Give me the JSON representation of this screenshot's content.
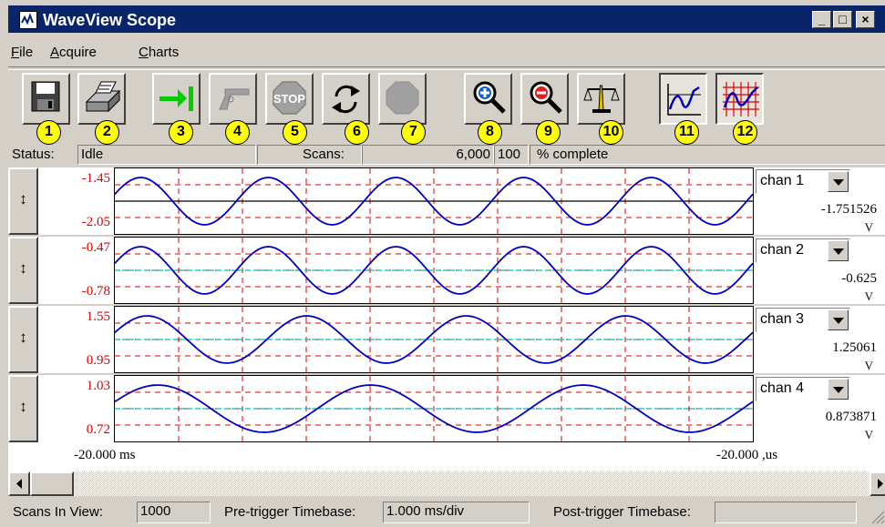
{
  "window": {
    "title": "WaveView Scope",
    "controls": [
      "_",
      "□",
      "×"
    ]
  },
  "menu": [
    {
      "label": "File",
      "accel": "F",
      "rest": "ile"
    },
    {
      "label": "Acquire",
      "accel": "A",
      "rest": "cquire"
    },
    {
      "label": "Charts",
      "accel": "C",
      "rest": "harts"
    }
  ],
  "toolbar": {
    "buttons": [
      {
        "icon": "save-disk-icon",
        "badge": "1"
      },
      {
        "icon": "printer-icon",
        "badge": "2"
      },
      {
        "icon": "arm-trigger-arrow-icon",
        "badge": "3"
      },
      {
        "icon": "trigger-gun-icon",
        "badge": "4"
      },
      {
        "icon": "stop-sign-icon",
        "badge": "5"
      },
      {
        "icon": "cycle-arrows-icon",
        "badge": "6"
      },
      {
        "icon": "octagon-icon",
        "badge": "7"
      },
      {
        "icon": "zoom-in-icon",
        "badge": "8"
      },
      {
        "icon": "zoom-out-icon",
        "badge": "9"
      },
      {
        "icon": "scale-balance-icon",
        "badge": "10"
      },
      {
        "icon": "single-chart-icon",
        "badge": "11"
      },
      {
        "icon": "multi-chart-grid-icon",
        "badge": "12"
      }
    ]
  },
  "status": {
    "status_label": "Status:",
    "status_value": "Idle",
    "scans_label": "Scans:",
    "scans_value": "6,000",
    "percent_value": "100",
    "percent_label": "% complete"
  },
  "channels": [
    {
      "ymax": "-1.45",
      "ymin": "-2.05",
      "name": "chan 1",
      "value": "-1.751526",
      "unit": "V",
      "cycles": 5.0,
      "phase": 0.0,
      "mid_line": true,
      "mid_color": "#000000"
    },
    {
      "ymax": "-0.47",
      "ymin": "-0.78",
      "name": "chan 2",
      "value": "-0.625",
      "unit": "V",
      "cycles": 5.0,
      "phase": 0.0,
      "mid_line": true,
      "mid_color": "#00c0c0"
    },
    {
      "ymax": "1.55",
      "ymin": "0.95",
      "name": "chan 3",
      "value": "1.25061",
      "unit": "V",
      "cycles": 4.0,
      "phase": 0.0,
      "mid_line": true,
      "mid_color": "#00c0c0"
    },
    {
      "ymax": "1.03",
      "ymin": "0.72",
      "name": "chan 4",
      "value": "0.873871",
      "unit": "V",
      "cycles": 3.0,
      "phase": 0.0,
      "mid_line": true,
      "mid_color": "#00c0c0"
    }
  ],
  "timeaxis": {
    "left": "-20.000 ms",
    "right": "-20.000 ,us"
  },
  "bottom": {
    "scans_in_view_label": "Scans In View:",
    "scans_in_view_value": "1000",
    "pre_trigger_label": "Pre-trigger Timebase:",
    "pre_trigger_value": "1.000 ms/div",
    "post_trigger_label": "Post-trigger Timebase:",
    "post_trigger_value": ""
  },
  "colors": {
    "titlebar": "#0a246a",
    "grid": "#e00000",
    "trace": "#0000c0",
    "badge": "#ffff00"
  }
}
